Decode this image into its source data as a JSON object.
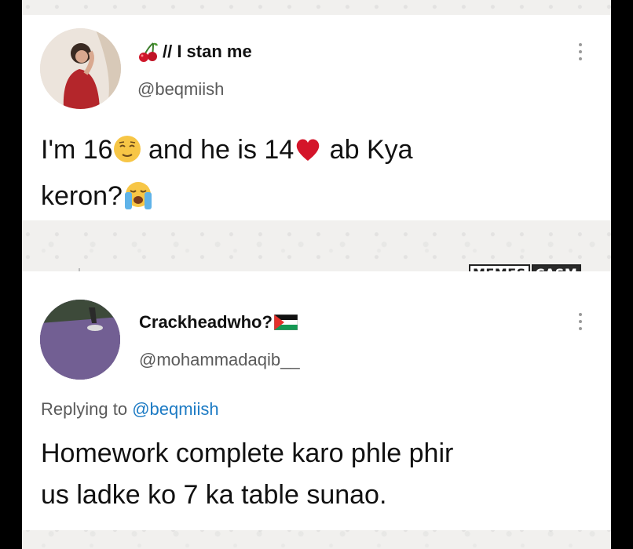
{
  "tweet": {
    "display_name": "// I stan me",
    "handle": "@beqmiish",
    "text_line1_part1": "I'm 16",
    "text_line1_part2": " and he is 14",
    "text_line1_part3": " ab Kya",
    "text_line2": "keron?",
    "name_icon": "cherries-icon",
    "emojis": [
      "relieved-face-emoji",
      "red-heart-emoji",
      "loudly-crying-face-emoji"
    ]
  },
  "reply": {
    "display_name": "Crackheadwho?",
    "handle": "@mohammadaqib__",
    "replying_prefix": "Replying to ",
    "replying_handle": "@beqmiish",
    "text_line1": "Homework complete karo phle phir",
    "text_line2": "us ladke ko 7 ka table sunao.",
    "name_icon": "palestine-flag-icon"
  },
  "watermark": {
    "part1": "MEMES",
    "part2": "CASM"
  },
  "colors": {
    "accent_link": "#1d7bc4",
    "text_primary": "#111111",
    "text_secondary": "#5a5a5a"
  }
}
